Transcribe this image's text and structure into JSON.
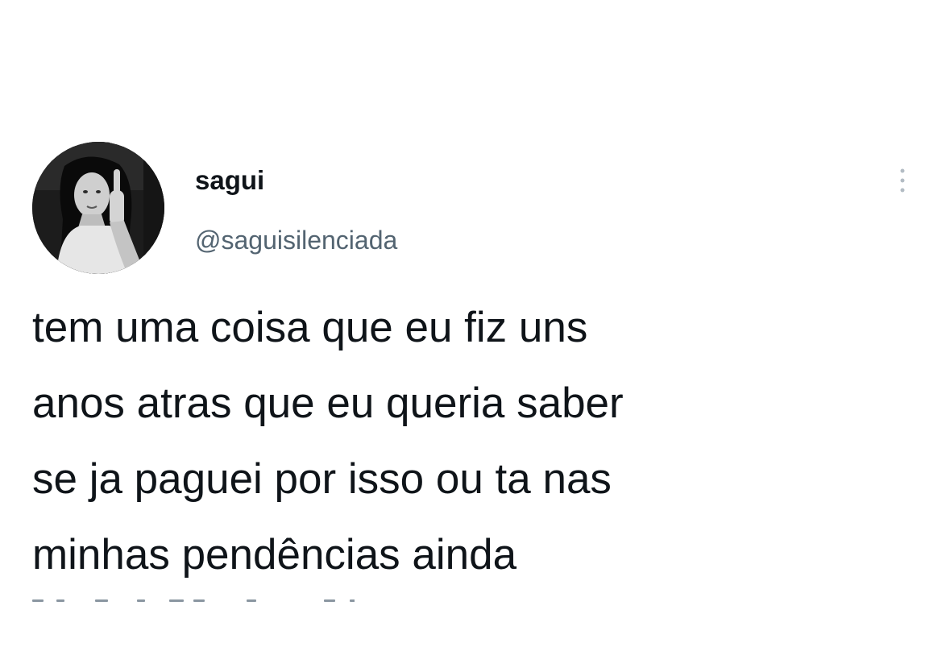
{
  "tweet": {
    "author": {
      "display_name": "sagui",
      "handle": "@saguisilenciada",
      "avatar_icon": "profile-photo"
    },
    "text": "tem uma coisa que eu fiz uns\nanos atras que eu queria saber\nse ja paguei por isso ou ta nas\nminhas pendências ainda",
    "more_icon": "more-vertical-icon"
  },
  "colors": {
    "text_primary": "#0f1419",
    "text_secondary": "#536471",
    "background": "#ffffff"
  }
}
